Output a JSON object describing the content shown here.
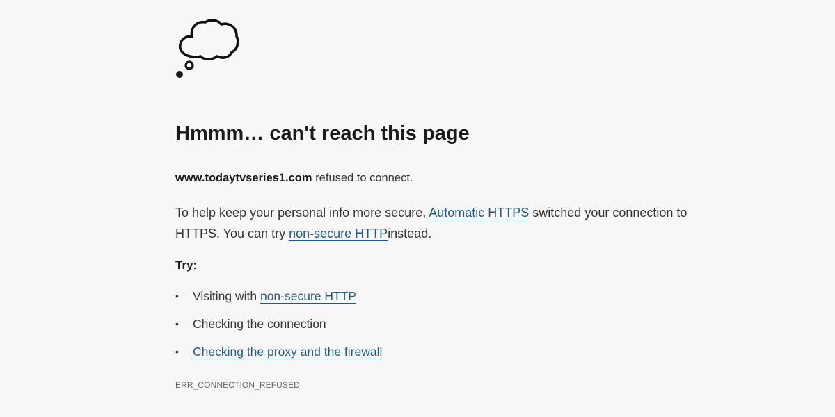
{
  "page": {
    "heading": "Hmmm… can't reach this page",
    "host": "www.todaytvseries1.com",
    "refused_text": "refused to connect.",
    "explain": {
      "part1": "To help keep your personal info more secure,",
      "link1": "Automatic HTTPS",
      "part2": "switched your connection to HTTPS. You can try",
      "link2": "non-secure HTTP",
      "part3": "instead."
    },
    "try_label": "Try:",
    "suggestions": [
      {
        "prefix": "Visiting with",
        "link": "non-secure HTTP"
      },
      {
        "text": "Checking the connection"
      },
      {
        "link": "Checking the proxy and the firewall"
      }
    ],
    "error_code": "ERR_CONNECTION_REFUSED"
  },
  "icons": {
    "illustration": "thought-cloud-icon",
    "bullet": "•"
  },
  "colors": {
    "background": "#f7f7f7",
    "text": "#1b1b1b",
    "body_text": "#333333",
    "link": "#1f5c8a",
    "error_code": "#666666"
  }
}
